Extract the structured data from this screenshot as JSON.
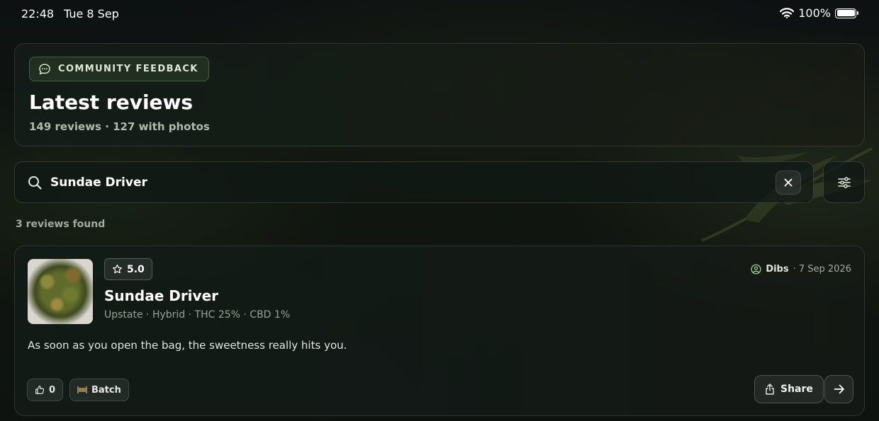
{
  "status_bar": {
    "time": "22:48",
    "date": "Tue 8 Sep",
    "battery_text": "100%",
    "battery_level": 1.0
  },
  "header": {
    "pill_label": "COMMUNITY FEEDBACK",
    "pill_icon": "chat-bubble-icon",
    "title": "Latest reviews",
    "subtitle": "149 reviews · 127 with photos"
  },
  "search": {
    "value": "Sundae Driver",
    "placeholder": "",
    "clear_icon": "close-icon",
    "filter_icon": "sliders-icon"
  },
  "results": {
    "count_text": "3 reviews found"
  },
  "reviews": [
    {
      "rating": "5.0",
      "title": "Sundae Driver",
      "meta": "Upstate · Hybrid · THC 25% · CBD 1%",
      "author": "Dibs",
      "date_text": "· 7 Sep 2026",
      "body": "As soon as you open the bag, the sweetness really hits you.",
      "likes": "0",
      "batch_label": "Batch",
      "share_label": "Share"
    }
  ],
  "colors": {
    "background": "#0e1310",
    "accent_green": "#dfe8d6",
    "muted_text": "#9aa196"
  }
}
